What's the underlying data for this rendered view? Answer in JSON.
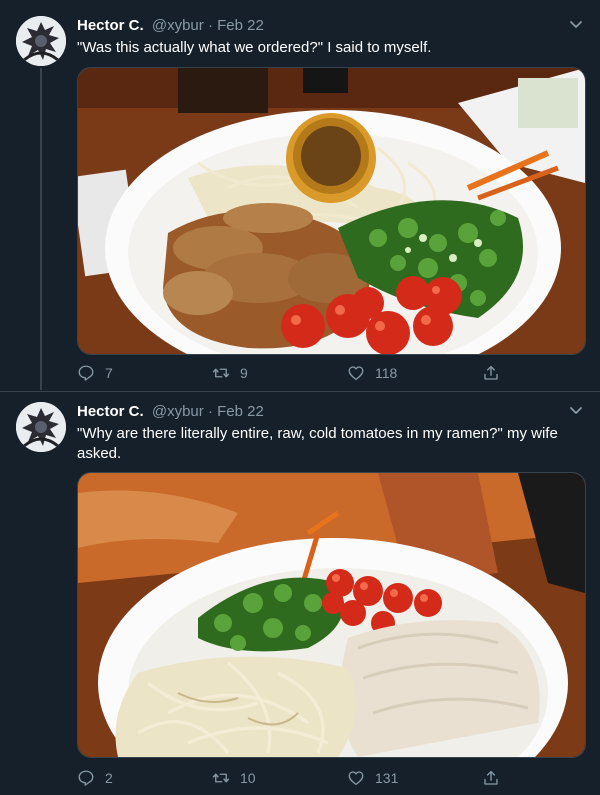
{
  "tweets": [
    {
      "author": {
        "name": "Hector C.",
        "handle": "@xybur"
      },
      "separator": "·",
      "date": "Feb 22",
      "text": "\"Was this actually what we ordered?\" I said to myself.",
      "stats": {
        "replies": "7",
        "retweets": "9",
        "likes": "118"
      },
      "icons": [
        "avatar-image",
        "chevron-down-icon",
        "reply-icon",
        "retweet-icon",
        "like-icon",
        "share-icon"
      ]
    },
    {
      "author": {
        "name": "Hector C.",
        "handle": "@xybur"
      },
      "separator": "·",
      "date": "Feb 22",
      "text": "\"Why are there literally entire, raw, cold tomatoes in my ramen?\" my wife asked.",
      "stats": {
        "replies": "2",
        "retweets": "10",
        "likes": "131"
      },
      "icons": [
        "avatar-image",
        "chevron-down-icon",
        "reply-icon",
        "retweet-icon",
        "like-icon",
        "share-icon"
      ]
    }
  ],
  "colors": {
    "background": "#15202b",
    "border": "#38444d",
    "secondary_text": "#8899a6",
    "primary_text": "#ffffff"
  }
}
